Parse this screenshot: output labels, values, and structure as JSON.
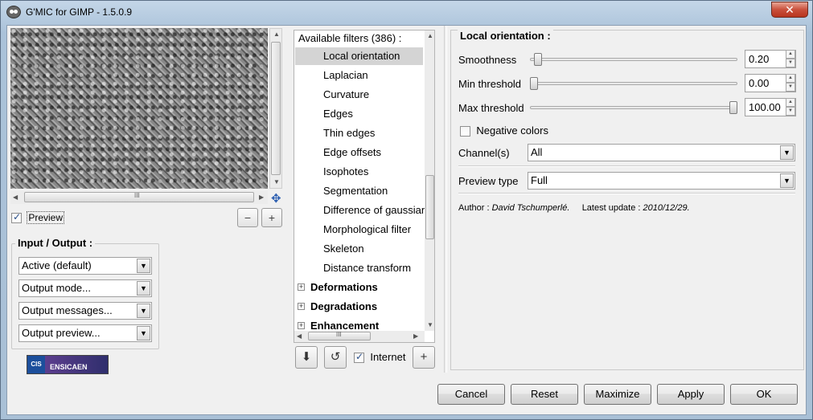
{
  "window": {
    "title": "G'MIC for GIMP - 1.5.0.9",
    "close_glyph": "✕"
  },
  "preview": {
    "checkbox_label": "Preview",
    "checked": true,
    "zoom_out_glyph": "−",
    "zoom_in_glyph": "+",
    "scroll_grip": "III",
    "move_glyph": "✥"
  },
  "io": {
    "title": "Input / Output :",
    "combos": [
      {
        "value": "Active (default)"
      },
      {
        "value": "Output mode..."
      },
      {
        "value": "Output messages..."
      },
      {
        "value": "Output preview..."
      }
    ],
    "logo_left": "CIS",
    "logo_right": "ENSICAEN"
  },
  "filters": {
    "header": "Available filters (386) :",
    "items": [
      {
        "label": "Local orientation",
        "selected": true
      },
      {
        "label": "Laplacian"
      },
      {
        "label": "Curvature"
      },
      {
        "label": "Edges"
      },
      {
        "label": "Thin edges"
      },
      {
        "label": "Edge offsets"
      },
      {
        "label": "Isophotes"
      },
      {
        "label": "Segmentation"
      },
      {
        "label": "Difference of gaussian"
      },
      {
        "label": "Morphological filter"
      },
      {
        "label": "Skeleton"
      },
      {
        "label": "Distance transform"
      }
    ],
    "categories": [
      "Deformations",
      "Degradations",
      "Enhancement"
    ],
    "expand_glyph": "+",
    "scroll_grip": "III",
    "internet_label": "Internet",
    "internet_checked": true,
    "add_glyph": "+"
  },
  "params": {
    "title": "Local orientation :",
    "sliders": [
      {
        "label": "Smoothness",
        "value": "0.20",
        "fraction": 0.02
      },
      {
        "label": "Min threshold",
        "value": "0.00",
        "fraction": 0.0
      },
      {
        "label": "Max threshold",
        "value": "100.00",
        "fraction": 1.0
      }
    ],
    "negative_colors_label": "Negative colors",
    "negative_colors_checked": false,
    "channels_label": "Channel(s)",
    "channels_value": "All",
    "preview_type_label": "Preview type",
    "preview_type_value": "Full",
    "author_label": "Author :",
    "author_name": "David Tschumperlé.",
    "update_label": "Latest update :",
    "update_date": "2010/12/29."
  },
  "buttons": {
    "cancel": "Cancel",
    "reset": "Reset",
    "maximize": "Maximize",
    "apply": "Apply",
    "ok": "OK"
  }
}
